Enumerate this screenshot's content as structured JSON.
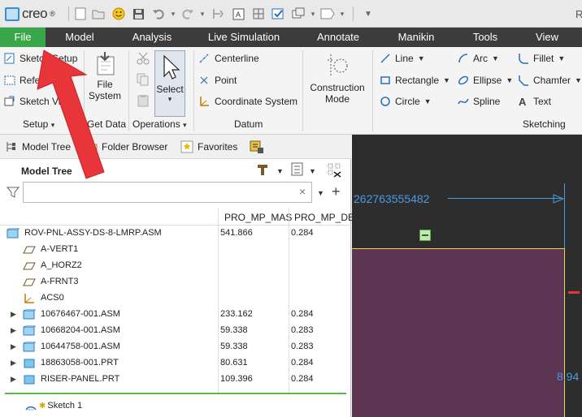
{
  "app": {
    "logo_text": "creo",
    "logo_mark": "®",
    "title_fragment": "R"
  },
  "quick_access": [
    "new-icon",
    "open-icon",
    "smiley-icon",
    "save-icon",
    "undo-icon",
    "redo-icon",
    "regenerate-icon",
    "annotation-icon",
    "window-icon",
    "check-icon",
    "windows-icon",
    "close-window-icon"
  ],
  "menu": {
    "tabs": [
      {
        "label": "File",
        "x": 0
      },
      {
        "label": "Model"
      },
      {
        "label": "Analysis"
      },
      {
        "label": "Live Simulation"
      },
      {
        "label": "Annotate"
      },
      {
        "label": "Manikin"
      },
      {
        "label": "Tools"
      },
      {
        "label": "View"
      }
    ]
  },
  "ribbon": {
    "setup": {
      "sketch_setup": "Sketch Setup",
      "references": "References",
      "sketch_view": "Sketch View",
      "group": "Setup"
    },
    "get_data": {
      "file_system_1": "File",
      "file_system_2": "System",
      "group": "Get Data"
    },
    "operations": {
      "select": "Select",
      "group": "Operations"
    },
    "datum": {
      "centerline": "Centerline",
      "point": "Point",
      "coordinate_system": "Coordinate System",
      "group": "Datum"
    },
    "construction": {
      "line1": "Construction",
      "line2": "Mode"
    },
    "sketching": {
      "line": "Line",
      "rectangle": "Rectangle",
      "circle": "Circle",
      "arc": "Arc",
      "ellipse": "Ellipse",
      "spline": "Spline",
      "fillet": "Fillet",
      "chamfer": "Chamfer",
      "text": "Text",
      "group": "Sketching"
    }
  },
  "navigator": {
    "tabs": [
      "Model Tree",
      "Folder Browser",
      "Favorites"
    ],
    "title": "Model Tree",
    "filter_placeholder": "",
    "columns": [
      "PRO_MP_MAS",
      "PRO_MP_DE"
    ],
    "rows": [
      {
        "name": "ROV-PNL-ASSY-DS-8-LMRP.ASM",
        "mass": "541.866",
        "den": "0.284",
        "icon": "assembly-icon",
        "indent": 0,
        "expand": false
      },
      {
        "name": "A-VERT1",
        "mass": "",
        "den": "",
        "icon": "datum-plane-icon",
        "indent": 1,
        "expand": false
      },
      {
        "name": "A_HORZ2",
        "mass": "",
        "den": "",
        "icon": "datum-plane-icon",
        "indent": 1,
        "expand": false
      },
      {
        "name": "A-FRNT3",
        "mass": "",
        "den": "",
        "icon": "datum-plane-icon",
        "indent": 1,
        "expand": false
      },
      {
        "name": "ACS0",
        "mass": "",
        "den": "",
        "icon": "csys-icon",
        "indent": 1,
        "expand": false
      },
      {
        "name": "10676467-001.ASM",
        "mass": "233.162",
        "den": "0.284",
        "icon": "assembly-icon",
        "indent": 1,
        "expand": true
      },
      {
        "name": "10668204-001.ASM",
        "mass": "59.338",
        "den": "0.283",
        "icon": "assembly-icon",
        "indent": 1,
        "expand": true
      },
      {
        "name": "10644758-001.ASM",
        "mass": "59.338",
        "den": "0.283",
        "icon": "assembly-icon",
        "indent": 1,
        "expand": true
      },
      {
        "name": "18863058-001.PRT",
        "mass": "80.631",
        "den": "0.284",
        "icon": "part-icon",
        "indent": 1,
        "expand": true
      },
      {
        "name": "RISER-PANEL.PRT",
        "mass": "109.396",
        "den": "0.284",
        "icon": "part-icon",
        "indent": 1,
        "expand": true
      }
    ],
    "sketch_item": "Sketch 1"
  },
  "graphics": {
    "dim_top": "262763555482",
    "dim_right": "8.94"
  },
  "colors": {
    "file_tab": "#3aa64a",
    "menubar": "#3c3c3c",
    "sketch_plane": "#5b3552",
    "dimension": "#4a9be0",
    "annotation_arrow": "#e8353a"
  }
}
